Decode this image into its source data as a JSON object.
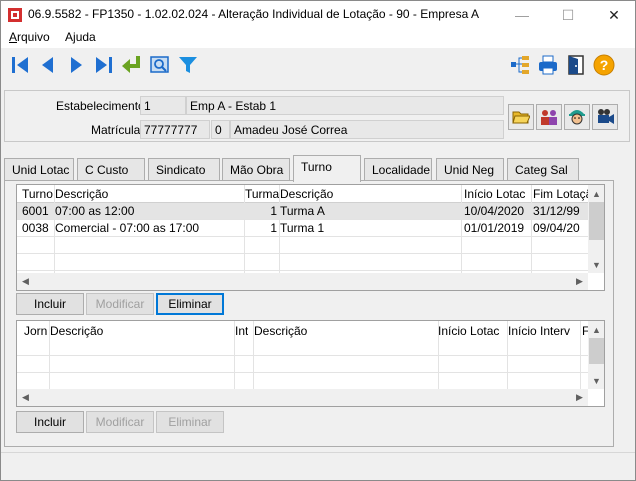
{
  "window": {
    "title": "06.9.5582 - FP1350 - 1.02.02.024 - Alteração Individual de Lotação - 90 - Empresa A",
    "minimize": "—",
    "maximize": "☐",
    "close": "✕"
  },
  "menu": {
    "arquivo": {
      "first": "A",
      "rest": "rquivo"
    },
    "ajuda": {
      "first": "A",
      "mid": "j",
      "rest": "uda"
    }
  },
  "toolbar": {
    "icons": [
      "first-record-icon",
      "previous-record-icon",
      "next-record-icon",
      "last-record-icon",
      "confirm-icon",
      "search-icon",
      "filter-icon",
      "tree-icon",
      "print-icon",
      "exit-icon",
      "help-icon"
    ],
    "colors": {
      "nav": "#1f6fd1",
      "confirm": "#6aa321",
      "help": "#f5a300",
      "print": "#1b6ac9"
    }
  },
  "header": {
    "estab_label": "Estabelecimento:",
    "estab_code": "1",
    "estab_name": "Emp A - Estab 1",
    "matricula_label": "Matrícula:",
    "matricula_code": "77777777",
    "matricula_digit": "0",
    "matricula_name": "Amadeu José Correa"
  },
  "tabs": [
    "Unid Lotac",
    "C Custo",
    "Sindicato",
    "Mão Obra",
    "Turno",
    "Localidade",
    "Unid Neg",
    "Categ Sal"
  ],
  "active_tab": "Turno",
  "turno_grid": {
    "headers": [
      "Turno",
      "Descrição",
      "Turma",
      "Descrição",
      "Início Lotac",
      "Fim Lotação"
    ],
    "rows": [
      [
        "6001",
        "07:00 as 12:00",
        "1",
        "Turma A",
        "10/04/2020",
        "31/12/99"
      ],
      [
        "0038",
        "Comercial - 07:00 as 17:00",
        "1",
        "Turma 1",
        "01/01/2019",
        "09/04/20"
      ]
    ]
  },
  "turno_buttons": {
    "incluir": "Incluir",
    "modificar": "Modificar",
    "eliminar": "Eliminar"
  },
  "jornada_grid": {
    "headers": [
      "Jorn",
      "Descrição",
      "Int",
      "Descrição",
      "Início Lotac",
      "Início Interv",
      "F"
    ]
  },
  "jornada_buttons": {
    "incluir": "Incluir",
    "modificar": "Modificar",
    "eliminar": "Eliminar"
  }
}
